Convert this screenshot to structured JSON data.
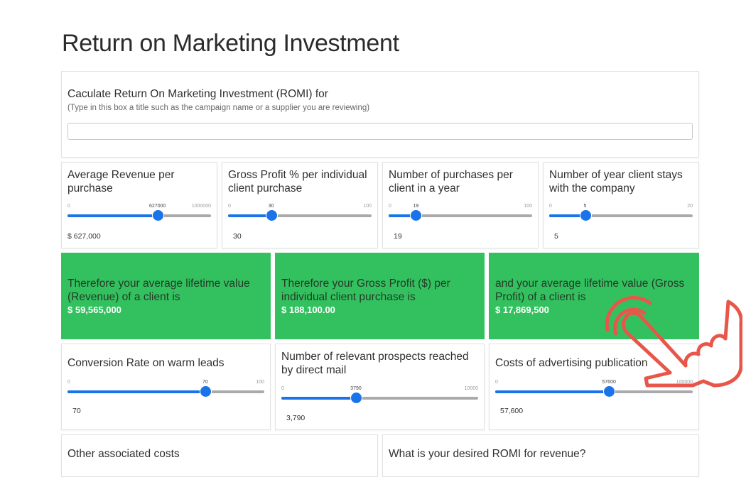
{
  "page": {
    "title": "Return on Marketing Investment"
  },
  "campaign": {
    "label": "Caculate Return On Marketing Investment (ROMI) for",
    "hint": "(Type in this box a title such as the campaign name or a supplier you are reviewing)",
    "value": ""
  },
  "inputs_row1": [
    {
      "label": "Average Revenue per purchase",
      "min": "0",
      "max": "1000000",
      "current": "627000",
      "fraction": 0.627,
      "value": "$  627,000"
    },
    {
      "label": "Gross Profit % per individual client purchase",
      "min": "0",
      "max": "100",
      "current": "30",
      "fraction": 0.3,
      "value": "30"
    },
    {
      "label": "Number of purchases per client in a year",
      "min": "0",
      "max": "100",
      "current": "19",
      "fraction": 0.19,
      "value": "19"
    },
    {
      "label": "Number of year client stays with the company",
      "min": "0",
      "max": "20",
      "current": "5",
      "fraction": 0.25,
      "value": "5"
    }
  ],
  "results": [
    {
      "label": "Therefore your average lifetime value (Revenue) of a client is",
      "value": "$ 59,565,000"
    },
    {
      "label": "Therefore your Gross Profit ($) per individual client purchase is",
      "value": "$ 188,100.00"
    },
    {
      "label": "and your average lifetime value (Gross Profit) of a client is",
      "value": "$ 17,869,500"
    }
  ],
  "inputs_row2": [
    {
      "label": "Conversion Rate on warm leads",
      "min": "0",
      "max": "100",
      "current": "70",
      "fraction": 0.7,
      "value": "70"
    },
    {
      "label": "Number of relevant prospects reached by direct mail",
      "min": "0",
      "max": "10000",
      "current": "3790",
      "fraction": 0.379,
      "value": "3,790"
    },
    {
      "label": "Costs of advertising publication",
      "min": "0",
      "max": "100000",
      "current": "57600",
      "fraction": 0.576,
      "value": "57,600"
    }
  ],
  "row3": [
    {
      "label": "Other associated costs"
    },
    {
      "label": "What is your desired ROMI for revenue?"
    }
  ],
  "colors": {
    "accent": "#1a73e8",
    "result_bg": "#33c15f",
    "hand": "#e8564a"
  }
}
